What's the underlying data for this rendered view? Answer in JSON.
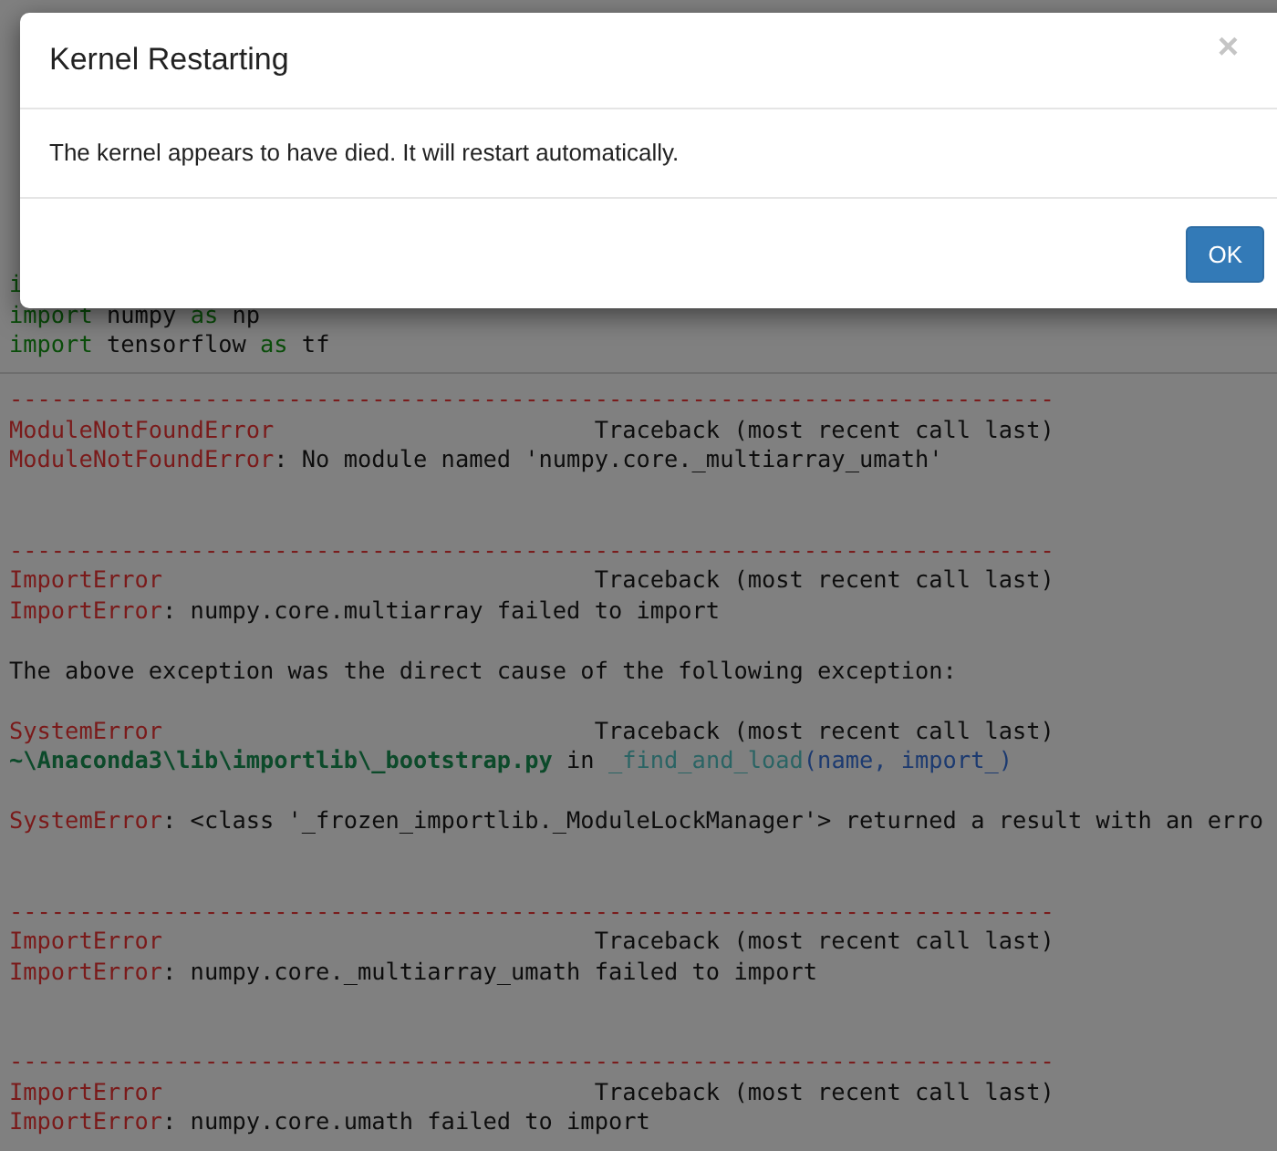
{
  "code_cell": {
    "lines": [
      {
        "kind": "text",
        "segments": [
          {
            "text": "i",
            "kind": "keyword"
          }
        ]
      },
      {
        "kind": "text",
        "segments": [
          {
            "text": "import",
            "kind": "keyword"
          },
          {
            "text": " numpy ",
            "kind": "plain"
          },
          {
            "text": "as",
            "kind": "keyword"
          },
          {
            "text": " np",
            "kind": "plain"
          }
        ]
      },
      {
        "kind": "text",
        "segments": [
          {
            "text": "import",
            "kind": "keyword"
          },
          {
            "text": " tensorflow ",
            "kind": "plain"
          },
          {
            "text": "as",
            "kind": "keyword"
          },
          {
            "text": " tf",
            "kind": "plain"
          }
        ]
      }
    ]
  },
  "output": {
    "lines": [
      {
        "kind": "text",
        "segments": [
          {
            "text": "---------------------------------------------------------------------------",
            "kind": "rule"
          }
        ]
      },
      {
        "kind": "text",
        "segments": [
          {
            "text": "ModuleNotFoundError",
            "kind": "error"
          },
          {
            "text": "                       Traceback (most recent call last)",
            "kind": "plain"
          }
        ]
      },
      {
        "kind": "text",
        "segments": [
          {
            "text": "ModuleNotFoundError",
            "kind": "error"
          },
          {
            "text": ": No module named 'numpy.core._multiarray_umath'",
            "kind": "plain"
          }
        ]
      },
      {
        "kind": "blank"
      },
      {
        "kind": "blank"
      },
      {
        "kind": "text",
        "segments": [
          {
            "text": "---------------------------------------------------------------------------",
            "kind": "rule"
          }
        ]
      },
      {
        "kind": "text",
        "segments": [
          {
            "text": "ImportError",
            "kind": "error"
          },
          {
            "text": "                               Traceback (most recent call last)",
            "kind": "plain"
          }
        ]
      },
      {
        "kind": "text",
        "segments": [
          {
            "text": "ImportError",
            "kind": "error"
          },
          {
            "text": ": numpy.core.multiarray failed to import",
            "kind": "plain"
          }
        ]
      },
      {
        "kind": "blank"
      },
      {
        "kind": "text",
        "segments": [
          {
            "text": "The above exception was the direct cause of the following exception:",
            "kind": "plain"
          }
        ]
      },
      {
        "kind": "blank"
      },
      {
        "kind": "text",
        "segments": [
          {
            "text": "SystemError",
            "kind": "error"
          },
          {
            "text": "                               Traceback (most recent call last)",
            "kind": "plain"
          }
        ]
      },
      {
        "kind": "text",
        "segments": [
          {
            "text": "~\\Anaconda3\\lib\\importlib\\_bootstrap.py",
            "kind": "path"
          },
          {
            "text": " in ",
            "kind": "plain"
          },
          {
            "text": "_find_and_load",
            "kind": "func"
          },
          {
            "text": "(name, import_)",
            "kind": "args"
          }
        ]
      },
      {
        "kind": "blank"
      },
      {
        "kind": "text",
        "segments": [
          {
            "text": "SystemError",
            "kind": "error"
          },
          {
            "text": ": <class '_frozen_importlib._ModuleLockManager'> returned a result with an erro",
            "kind": "plain"
          }
        ]
      },
      {
        "kind": "blank"
      },
      {
        "kind": "blank"
      },
      {
        "kind": "text",
        "segments": [
          {
            "text": "---------------------------------------------------------------------------",
            "kind": "rule"
          }
        ]
      },
      {
        "kind": "text",
        "segments": [
          {
            "text": "ImportError",
            "kind": "error"
          },
          {
            "text": "                               Traceback (most recent call last)",
            "kind": "plain"
          }
        ]
      },
      {
        "kind": "text",
        "segments": [
          {
            "text": "ImportError",
            "kind": "error"
          },
          {
            "text": ": numpy.core._multiarray_umath failed to import",
            "kind": "plain"
          }
        ]
      },
      {
        "kind": "blank"
      },
      {
        "kind": "blank"
      },
      {
        "kind": "text",
        "segments": [
          {
            "text": "---------------------------------------------------------------------------",
            "kind": "rule"
          }
        ]
      },
      {
        "kind": "text",
        "segments": [
          {
            "text": "ImportError",
            "kind": "error"
          },
          {
            "text": "                               Traceback (most recent call last)",
            "kind": "plain"
          }
        ]
      },
      {
        "kind": "text",
        "segments": [
          {
            "text": "ImportError",
            "kind": "error"
          },
          {
            "text": ": numpy.core.umath failed to import",
            "kind": "plain"
          }
        ]
      }
    ]
  },
  "dialog": {
    "title": "Kernel Restarting",
    "close": "×",
    "message": "The kernel appears to have died. It will restart automatically.",
    "buttons": [
      "OK"
    ]
  }
}
